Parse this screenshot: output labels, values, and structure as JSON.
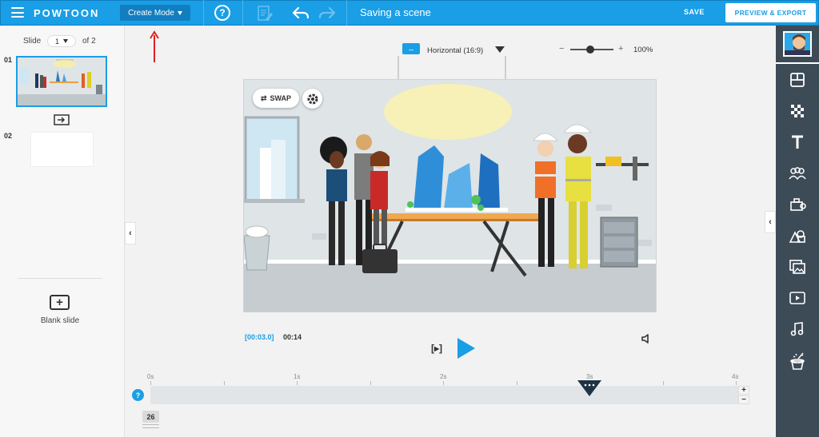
{
  "header": {
    "logo": "POWTOON",
    "mode_label": "Create Mode",
    "help": "?",
    "scene_title": "Saving a scene",
    "save_label": "SAVE",
    "export_label": "PREVIEW & EXPORT"
  },
  "slides": {
    "slide_label": "Slide",
    "current": "1",
    "of_label": "of 2",
    "items": [
      {
        "num": "01"
      },
      {
        "num": "02"
      }
    ],
    "blank_label": "Blank slide"
  },
  "canvas": {
    "orientation": "Horizontal (16:9)",
    "zoom_minus": "−",
    "zoom_plus": "+",
    "zoom": "100%",
    "zoom_level": 0.5,
    "swap_label": "SWAP"
  },
  "playback": {
    "current_time": "[00:03.0]",
    "total_time": "00:14"
  },
  "timeline": {
    "ticks": [
      "0s",
      "1s",
      "2s",
      "3s",
      "4s"
    ],
    "help": "?",
    "plus": "+",
    "minus": "−",
    "frame": "26"
  },
  "toolbar": {
    "tools": [
      "layout-icon",
      "background-icon",
      "text-icon",
      "characters-icon",
      "props-icon",
      "shapes-icon",
      "images-icon",
      "video-icon",
      "music-icon",
      "magic-hat-icon"
    ]
  },
  "colors": {
    "accent": "#1a9ee6",
    "toolbar_bg": "#3d4b57",
    "annotation_arrow": "#e02020"
  }
}
